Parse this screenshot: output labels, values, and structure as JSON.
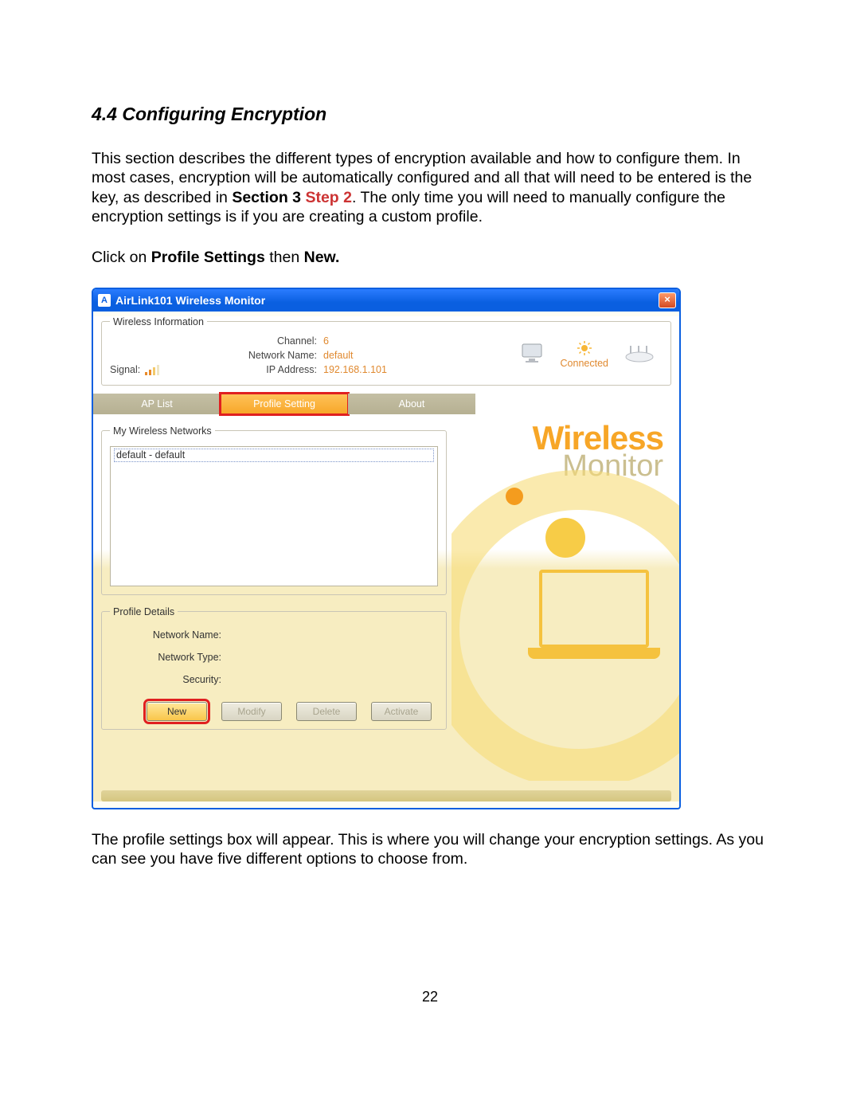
{
  "doc": {
    "section_title": "4.4 Configuring Encryption",
    "para1_prefix": "This section describes the different types of encryption available and how to configure them.  In most cases, encryption will be automatically configured and all that will need to be entered is the key, as described in ",
    "para1_bold": "Section 3 ",
    "para1_step": "Step 2",
    "para1_suffix": ".  The only time you will need to manually configure the encryption settings is if you are creating a custom profile.",
    "para2_prefix": "Click on ",
    "para2_bold1": "Profile Settings",
    "para2_mid": " then ",
    "para2_bold2": "New.",
    "para3": "The profile settings box will appear.  This is where you will change your encryption settings.  As you can see you have five different options to choose from.",
    "page_number": "22"
  },
  "window": {
    "title": "AirLink101 Wireless Monitor",
    "app_icon_char": "A",
    "close_char": "×"
  },
  "wireless_info": {
    "legend": "Wireless Information",
    "signal_label": "Signal:",
    "rows": [
      {
        "label": "Channel:",
        "value": "6"
      },
      {
        "label": "Network Name:",
        "value": "default"
      },
      {
        "label": "IP Address:",
        "value": "192.168.1.101"
      }
    ],
    "status_label": "Connected"
  },
  "tabs": {
    "ap_list": "AP List",
    "profile_setting": "Profile Setting",
    "about": "About"
  },
  "branding": {
    "line1": "Wireless",
    "line2": "Monitor"
  },
  "networks": {
    "legend": "My Wireless Networks",
    "items": [
      "default - default"
    ]
  },
  "profile_details": {
    "legend": "Profile Details",
    "rows": [
      {
        "label": "Network Name:",
        "value": ""
      },
      {
        "label": "Network Type:",
        "value": ""
      },
      {
        "label": "Security:",
        "value": ""
      }
    ]
  },
  "buttons": {
    "new": "New",
    "modify": "Modify",
    "delete": "Delete",
    "activate": "Activate"
  }
}
